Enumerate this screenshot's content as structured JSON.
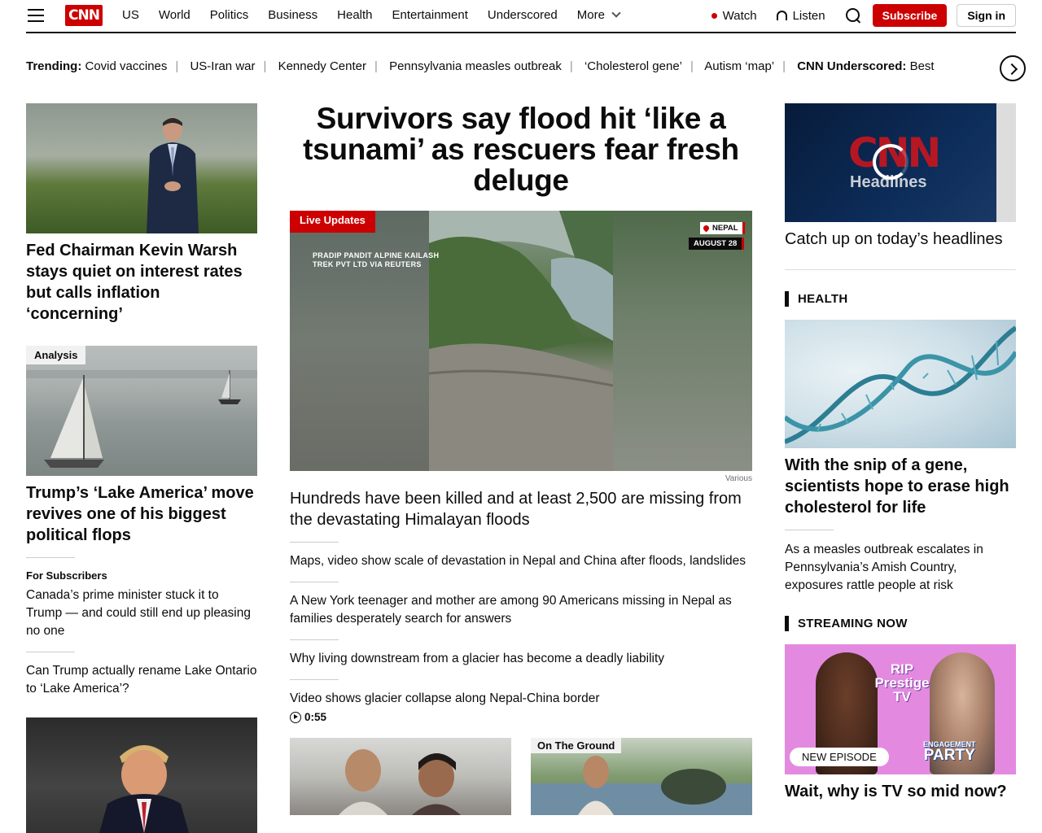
{
  "nav": {
    "logo": "CNN",
    "links": [
      "US",
      "World",
      "Politics",
      "Business",
      "Health",
      "Entertainment",
      "Underscored"
    ],
    "more": "More",
    "watch": "Watch",
    "listen": "Listen",
    "subscribe": "Subscribe",
    "signin": "Sign in"
  },
  "trending": {
    "label": "Trending:",
    "items": [
      "Covid vaccines",
      "US-Iran war",
      "Kennedy Center",
      "Pennsylvania measles outbreak",
      "‘Cholesterol gene’",
      "Autism ‘map’"
    ],
    "underscored_label": "CNN Underscored:",
    "underscored_text": "Best"
  },
  "left": {
    "story1": "Fed Chairman Kevin Warsh stays quiet on interest rates but calls inflation ‘concerning’",
    "analysis_badge": "Analysis",
    "story2": "Trump’s ‘Lake America’ move revives one of his biggest political flops",
    "for_subscribers": "For Subscribers",
    "story3": "Canada’s prime minister stuck it to Trump — and could still end up pleasing no one",
    "story4": "Can Trump actually rename Lake Ontario to ‘Lake America’?"
  },
  "mid": {
    "title": "Survivors say flood hit ‘like a tsunami’ as rescuers fear fresh deluge",
    "live_badge": "Live Updates",
    "image_credit": "PRADIP PANDIT ALPINE KAILASH TREK PVT LTD VIA REUTERS",
    "location": "NEPAL",
    "date": "AUGUST 28",
    "image_caption": "Various",
    "lead": "Hundreds have been killed and at least 2,500 are missing from the devastating Himalayan floods",
    "links": [
      "Maps, video show scale of devastation in Nepal and China after floods, landslides",
      "A New York teenager and mother are among 90 Americans missing in Nepal as families desperately search for answers",
      "Why living downstream from a glacier has become a deadly liability",
      "Video shows glacier collapse along Nepal-China border"
    ],
    "video_duration": "0:55",
    "thumb2_badge": "On The Ground"
  },
  "right": {
    "video_logo": "CNN",
    "video_sub": "Headlines",
    "story1": "Catch up on today’s headlines",
    "health_label": "HEALTH",
    "story2": "With the snip of a gene, scientists hope to erase high cholesterol for life",
    "story3": "As a measles outbreak escalates in Pennsylvania’s Amish Country, exposures rattle people at risk",
    "streaming_label": "STREAMING NOW",
    "tv_title": "RIP Prestige TV",
    "tv_new_episode": "NEW EPISODE",
    "tv_party_top": "ENGAGEMENT",
    "tv_party": "PARTY",
    "story4": "Wait, why is TV so mid now?"
  }
}
